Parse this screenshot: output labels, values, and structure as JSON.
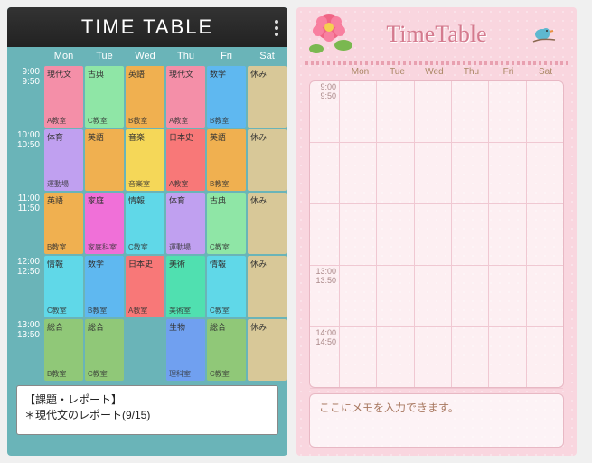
{
  "left": {
    "title": "TIME TABLE",
    "days": [
      "Mon",
      "Tue",
      "Wed",
      "Thu",
      "Fri",
      "Sat"
    ],
    "times": [
      {
        "start": "9:00",
        "end": "9:50"
      },
      {
        "start": "10:00",
        "end": "10:50"
      },
      {
        "start": "11:00",
        "end": "11:50"
      },
      {
        "start": "12:00",
        "end": "12:50"
      },
      {
        "start": "13:00",
        "end": "13:50"
      }
    ],
    "grid": [
      [
        {
          "subj": "現代文",
          "room": "A教室",
          "color": "#f48fa8"
        },
        {
          "subj": "古典",
          "room": "C教室",
          "color": "#8fe6a6"
        },
        {
          "subj": "英語",
          "room": "B教室",
          "color": "#f0b050"
        },
        {
          "subj": "現代文",
          "room": "A教室",
          "color": "#f48fa8"
        },
        {
          "subj": "数学",
          "room": "B教室",
          "color": "#5fb8f0"
        },
        {
          "subj": "休み",
          "room": "",
          "color": "#d8c898"
        }
      ],
      [
        {
          "subj": "体育",
          "room": "運動場",
          "color": "#c0a0f0"
        },
        {
          "subj": "英語",
          "room": "",
          "color": "#f0b050"
        },
        {
          "subj": "音楽",
          "room": "音楽室",
          "color": "#f5d758"
        },
        {
          "subj": "日本史",
          "room": "A教室",
          "color": "#f87878"
        },
        {
          "subj": "英語",
          "room": "B教室",
          "color": "#f0b050"
        },
        {
          "subj": "休み",
          "room": "",
          "color": "#d8c898"
        }
      ],
      [
        {
          "subj": "英語",
          "room": "B教室",
          "color": "#f0b050"
        },
        {
          "subj": "家庭",
          "room": "家庭科室",
          "color": "#f070d8"
        },
        {
          "subj": "情報",
          "room": "C教室",
          "color": "#60d8e8"
        },
        {
          "subj": "体育",
          "room": "運動場",
          "color": "#c0a0f0"
        },
        {
          "subj": "古典",
          "room": "C教室",
          "color": "#8fe6a6"
        },
        {
          "subj": "休み",
          "room": "",
          "color": "#d8c898"
        }
      ],
      [
        {
          "subj": "情報",
          "room": "C教室",
          "color": "#60d8e8"
        },
        {
          "subj": "数学",
          "room": "B教室",
          "color": "#5fb8f0"
        },
        {
          "subj": "日本史",
          "room": "A教室",
          "color": "#f87878"
        },
        {
          "subj": "美術",
          "room": "美術室",
          "color": "#50e0b0"
        },
        {
          "subj": "情報",
          "room": "C教室",
          "color": "#60d8e8"
        },
        {
          "subj": "休み",
          "room": "",
          "color": "#d8c898"
        }
      ],
      [
        {
          "subj": "総合",
          "room": "B教室",
          "color": "#90c878"
        },
        {
          "subj": "総合",
          "room": "C教室",
          "color": "#90c878"
        },
        {
          "subj": "",
          "room": "",
          "color": ""
        },
        {
          "subj": "生物",
          "room": "理科室",
          "color": "#70a0f0"
        },
        {
          "subj": "総合",
          "room": "C教室",
          "color": "#90c878"
        },
        {
          "subj": "休み",
          "room": "",
          "color": "#d8c898"
        }
      ]
    ],
    "memo_title": "【課題・レポート】",
    "memo_body": "＊現代文のレポート(9/15)"
  },
  "right": {
    "title": "TimeTable",
    "days": [
      "Mon",
      "Tue",
      "Wed",
      "Thu",
      "Fri",
      "Sat"
    ],
    "times": [
      {
        "start": "9:00",
        "end": "9:50"
      },
      {
        "start": "",
        "end": ""
      },
      {
        "start": "",
        "end": ""
      },
      {
        "start": "13:00",
        "end": "13:50"
      },
      {
        "start": "14:00",
        "end": "14:50"
      }
    ],
    "memo_placeholder": "ここにメモを入力できます。"
  }
}
